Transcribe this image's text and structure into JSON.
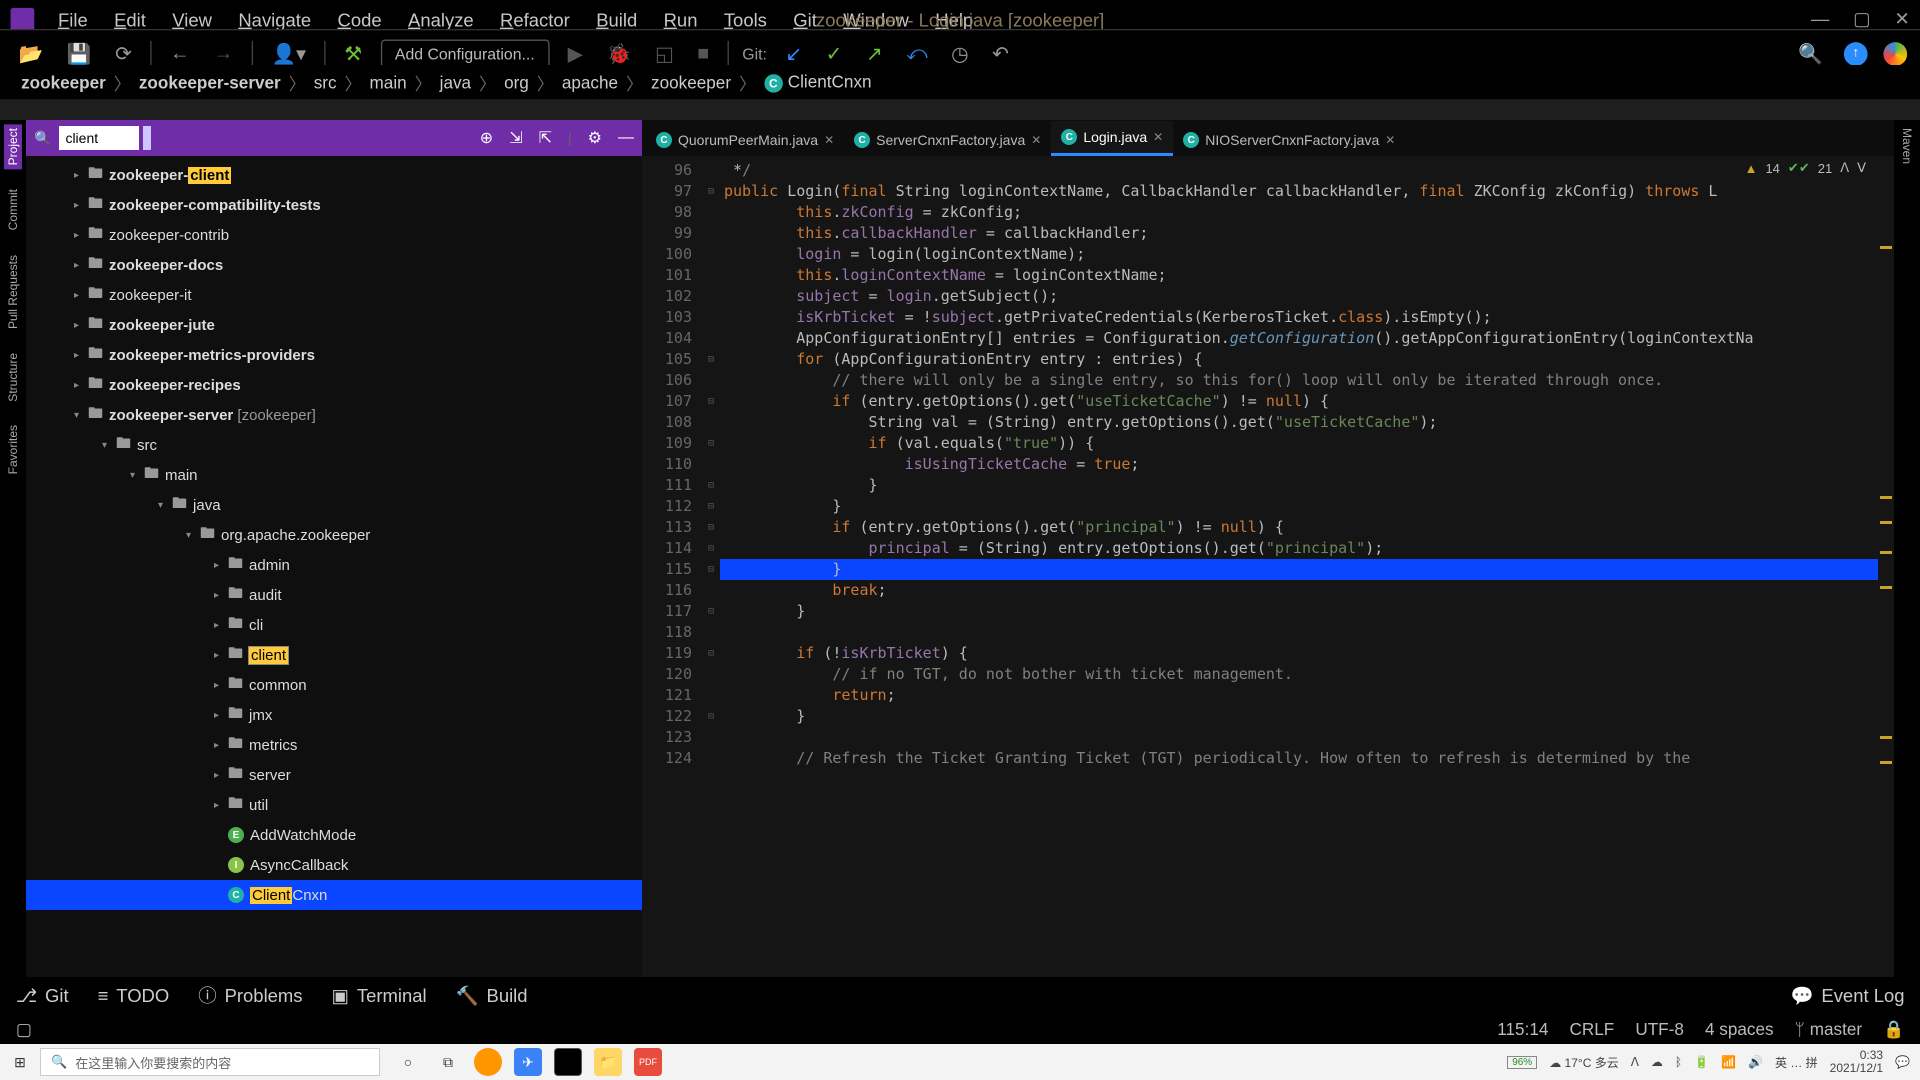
{
  "window_title": "zookeeper - Login.java [zookeeper]",
  "menu": [
    "File",
    "Edit",
    "View",
    "Navigate",
    "Code",
    "Analyze",
    "Refactor",
    "Build",
    "Run",
    "Tools",
    "Git",
    "Window",
    "Help"
  ],
  "toolbar": {
    "add_config": "Add Configuration...",
    "git_label": "Git:"
  },
  "breadcrumb": [
    "zookeeper",
    "zookeeper-server",
    "src",
    "main",
    "java",
    "org",
    "apache",
    "zookeeper",
    "ClientCnxn"
  ],
  "left_strip": [
    "Project",
    "Commit",
    "Pull Requests",
    "Structure",
    "Favorites"
  ],
  "right_strip": [
    "Maven"
  ],
  "search_value": "client",
  "tree": [
    {
      "d": 1,
      "c": "right",
      "ic": "folder",
      "label": "zookeeper-",
      "hl": "client",
      "bold": true
    },
    {
      "d": 1,
      "c": "right",
      "ic": "folder",
      "label": "zookeeper-compatibility-tests",
      "bold": true
    },
    {
      "d": 1,
      "c": "right",
      "ic": "folder",
      "label": "zookeeper-contrib"
    },
    {
      "d": 1,
      "c": "right",
      "ic": "folder",
      "label": "zookeeper-docs",
      "bold": true
    },
    {
      "d": 1,
      "c": "right",
      "ic": "folder",
      "label": "zookeeper-it"
    },
    {
      "d": 1,
      "c": "right",
      "ic": "folder",
      "label": "zookeeper-jute",
      "bold": true
    },
    {
      "d": 1,
      "c": "right",
      "ic": "folder",
      "label": "zookeeper-metrics-providers",
      "bold": true
    },
    {
      "d": 1,
      "c": "right",
      "ic": "folder",
      "label": "zookeeper-recipes",
      "bold": true
    },
    {
      "d": 1,
      "c": "down",
      "ic": "folder",
      "label": "zookeeper-server",
      "suffix": " [zookeeper]",
      "bold": true
    },
    {
      "d": 2,
      "c": "down",
      "ic": "folder",
      "label": "src"
    },
    {
      "d": 3,
      "c": "down",
      "ic": "folder",
      "label": "main"
    },
    {
      "d": 4,
      "c": "down",
      "ic": "folder",
      "label": "java"
    },
    {
      "d": 5,
      "c": "down",
      "ic": "folder",
      "label": "org.apache.zookeeper"
    },
    {
      "d": 6,
      "c": "right",
      "ic": "folder",
      "label": "admin"
    },
    {
      "d": 6,
      "c": "right",
      "ic": "folder",
      "label": "audit"
    },
    {
      "d": 6,
      "c": "right",
      "ic": "folder",
      "label": "cli"
    },
    {
      "d": 6,
      "c": "right",
      "ic": "folder",
      "hl": "client",
      "hlbox": true
    },
    {
      "d": 6,
      "c": "right",
      "ic": "folder",
      "label": "common"
    },
    {
      "d": 6,
      "c": "right",
      "ic": "folder",
      "label": "jmx"
    },
    {
      "d": 6,
      "c": "right",
      "ic": "folder",
      "label": "metrics"
    },
    {
      "d": 6,
      "c": "right",
      "ic": "folder",
      "label": "server"
    },
    {
      "d": 6,
      "c": "right",
      "ic": "folder",
      "label": "util"
    },
    {
      "d": 6,
      "ic": "E",
      "label": "AddWatchMode"
    },
    {
      "d": 6,
      "ic": "I",
      "label": "AsyncCallback"
    },
    {
      "d": 6,
      "ic": "C",
      "hl": "Client",
      "label2": "Cnxn",
      "selected": true
    }
  ],
  "tabs": [
    {
      "name": "QuorumPeerMain.java"
    },
    {
      "name": "ServerCnxnFactory.java"
    },
    {
      "name": "Login.java",
      "active": true
    },
    {
      "name": "NIOServerCnxnFactory.java"
    }
  ],
  "analysis": {
    "warn": 14,
    "typo": 21
  },
  "line_start": 96,
  "line_end": 124,
  "selected_line": 115,
  "code_lines": [
    " *<span class='k-com'>/</span>",
    "<span class='k-kw'>public</span> Login(<span class='k-kw'>final</span> String loginContextName, CallbackHandler callbackHandler, <span class='k-kw'>final</span> ZKConfig zkConfig) <span class='k-kw'>throws</span> L",
    "    <span class='k-th'>this</span>.<span class='k-fld'>zkConfig</span> = zkConfig;",
    "    <span class='k-th'>this</span>.<span class='k-fld'>callbackHandler</span> = callbackHandler;",
    "    <span class='k-fld'>login</span> = login(loginContextName);",
    "    <span class='k-th'>this</span>.<span class='k-fld'>loginContextName</span> = loginContextName;",
    "    <span class='k-fld'>subject</span> = <span class='k-fld'>login</span>.getSubject();",
    "    <span class='k-fld'>isKrbTicket</span> = !<span class='k-fld'>subject</span>.getPrivateCredentials(KerberosTicket.<span class='k-kw'>class</span>).isEmpty();",
    "    AppConfigurationEntry[] entries = Configuration.<span class='k-num'>getConfiguration</span>().getAppConfigurationEntry(loginContextNa",
    "    <span class='k-kw'>for</span> (AppConfigurationEntry entry : entries) {",
    "        <span class='k-com'>// there will only be a single entry, so this for() loop will only be iterated through once.</span>",
    "        <span class='k-kw'>if</span> (entry.getOptions().get(<span class='k-str'>\"useTicketCache\"</span>) != <span class='k-kw'>null</span>) {",
    "            String val = (String) entry.getOptions().get(<span class='k-str'>\"useTicketCache\"</span>);",
    "            <span class='k-kw'>if</span> (val.equals(<span class='k-str'>\"true\"</span>)) {",
    "                <span class='k-fld'>isUsingTicketCache</span> = <span class='k-kw'>true</span>;",
    "            }",
    "        }",
    "        <span class='k-kw'>if</span> (entry.getOptions().get(<span class='k-str'>\"principal\"</span>) != <span class='k-kw'>null</span>) {",
    "            <span class='k-fld'>principal</span> = (String) entry.getOptions().get(<span class='k-str'>\"principal\"</span>);",
    "        }",
    "        <span class='k-kw'>break</span>;",
    "    }",
    "",
    "    <span class='k-kw'>if</span> (!<span class='k-fld'>isKrbTicket</span>) {",
    "        <span class='k-com'>// if no TGT, do not bother with ticket management.</span>",
    "        <span class='k-kw'>return</span>;",
    "    }",
    "",
    "    <span class='k-com'>// Refresh the Ticket Granting Ticket (TGT) periodically. How often to refresh is determined by the</span>"
  ],
  "bottom_bar": {
    "git": "Git",
    "todo": "TODO",
    "problems": "Problems",
    "terminal": "Terminal",
    "build": "Build",
    "eventlog": "Event Log"
  },
  "status": {
    "pos": "115:14",
    "le": "CRLF",
    "enc": "UTF-8",
    "indent": "4 spaces",
    "branch": "master"
  },
  "taskbar": {
    "search_placeholder": "在这里输入你要搜索的内容",
    "battery": "96%",
    "weather": "17°C 多云",
    "ime": "英 … 拼",
    "time": "0:33",
    "date": "2021/12/1"
  }
}
